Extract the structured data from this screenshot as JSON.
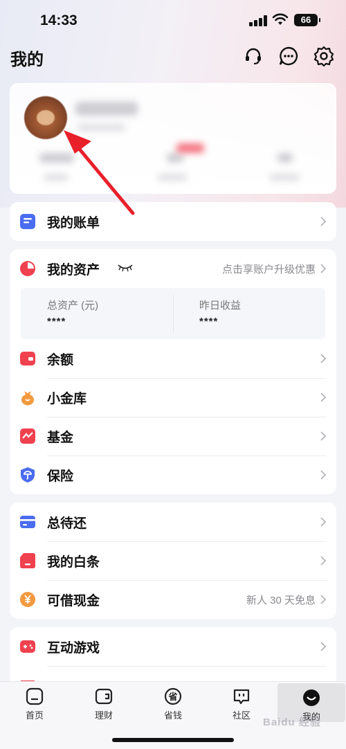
{
  "status": {
    "time": "14:33",
    "battery": "66"
  },
  "header": {
    "title": "我的"
  },
  "profile": {},
  "bill_row": {
    "label": "我的账单"
  },
  "assets": {
    "label": "我的资产",
    "promo": "点击享账户升级优惠",
    "total_label": "总资产 (元)",
    "total_value": "****",
    "yesterday_label": "昨日收益",
    "yesterday_value": "****",
    "items": [
      {
        "label": "余额"
      },
      {
        "label": "小金库"
      },
      {
        "label": "基金"
      },
      {
        "label": "保险"
      }
    ]
  },
  "credit": {
    "items": [
      {
        "label": "总待还",
        "right": ""
      },
      {
        "label": "我的白条",
        "right": ""
      },
      {
        "label": "可借现金",
        "right": "新人 30 天免息"
      }
    ]
  },
  "games": {
    "items": [
      {
        "label": "互动游戏"
      }
    ]
  },
  "tabbar": {
    "tabs": [
      {
        "label": "首页"
      },
      {
        "label": "理财"
      },
      {
        "label": "省钱"
      },
      {
        "label": "社区"
      },
      {
        "label": "我的"
      }
    ]
  },
  "watermark": "Baidu 经验",
  "colors": {
    "accent_red": "#f0414f",
    "blue": "#4a6cf0",
    "orange": "#f39a40"
  }
}
